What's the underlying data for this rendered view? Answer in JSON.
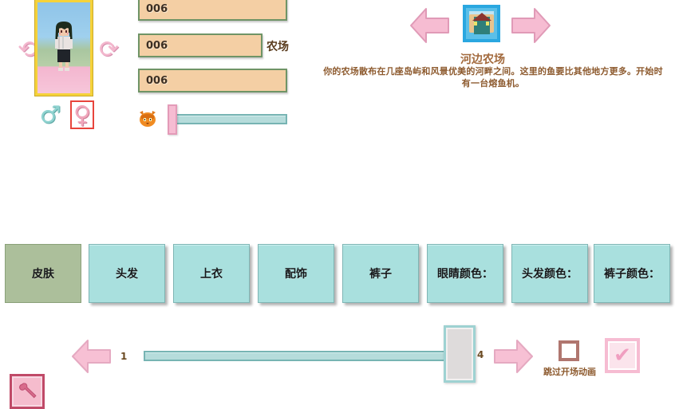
{
  "character": {
    "rotate_left_icon": "rotate-left-arrow",
    "rotate_right_icon": "rotate-right-arrow",
    "portrait_label": "character-preview",
    "gender": {
      "male_symbol": "♂",
      "female_symbol": "♀",
      "selected": "female"
    }
  },
  "fields": [
    {
      "name": "name-field",
      "value": "006",
      "label": ""
    },
    {
      "name": "farm-name-field",
      "value": "006",
      "label": "农场"
    },
    {
      "name": "favorite-field",
      "value": "006",
      "label": ""
    }
  ],
  "pet": {
    "icon": "cat-icon",
    "glyph": "🐱",
    "slider_name": "pet-slider"
  },
  "farm": {
    "prev_label": "previous-farm",
    "next_label": "next-farm",
    "icon_name": "riverland-farm-icon",
    "title": "河边农场",
    "description": "你的农场散布在几座岛屿和风景优美的河畔之间。这里的鱼要比其他地方更多。开始时有一台熔鱼机",
    "description_tail": "。"
  },
  "tabs": [
    {
      "label": "皮肤",
      "name": "tab-skin",
      "selected": true
    },
    {
      "label": "头发",
      "name": "tab-hair",
      "selected": false
    },
    {
      "label": "上衣",
      "name": "tab-shirt",
      "selected": false
    },
    {
      "label": "配饰",
      "name": "tab-accessory",
      "selected": false
    },
    {
      "label": "裤子",
      "name": "tab-pants",
      "selected": false
    },
    {
      "label": "眼睛颜色：",
      "name": "tab-eye-color",
      "selected": false
    },
    {
      "label": "头发颜色：",
      "name": "tab-hair-color",
      "selected": false
    },
    {
      "label": "裤子颜色：",
      "name": "tab-pants-color",
      "selected": false
    }
  ],
  "bottom": {
    "tool_icon": "wrench-icon",
    "prev_label": "previous-option",
    "next_label": "next-option",
    "value_left": "1",
    "value_right": "4",
    "slider_name": "option-slider",
    "skip_label": "跳过开场动画",
    "skip_checked": false,
    "ok_glyph": "✔"
  },
  "colors": {
    "field_bg": "#f4cfa4",
    "field_border": "#6f9466",
    "tab_bg": "#a9e0de",
    "tab_selected_bg": "#acbf9b",
    "pink": "#f6bcd2",
    "accent_red": "#e8453c",
    "title_brown": "#a2693c"
  }
}
